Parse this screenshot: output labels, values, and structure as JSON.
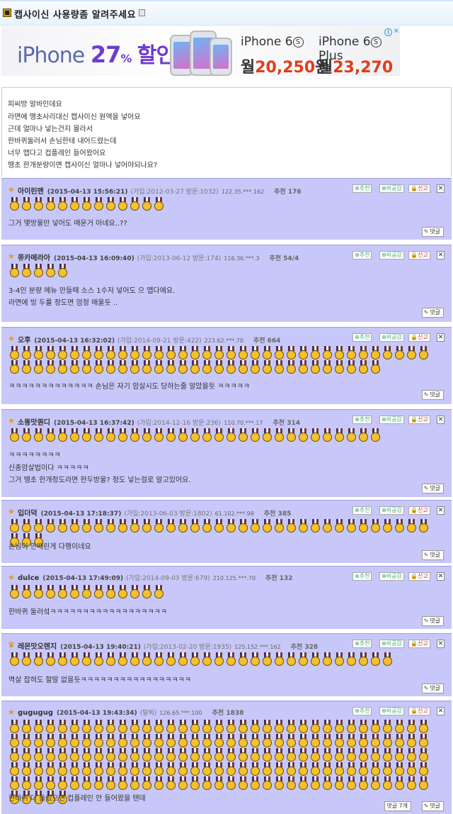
{
  "title": "캡사이신 사용량좀 알려주세요",
  "ad": {
    "left_text": "iPhone",
    "percent": "27",
    "percent_sign": "%",
    "sale": "할인!",
    "model1": "iPhone 6",
    "model2": "iPhone 6",
    "model_s": "S",
    "plus": "Plus",
    "price_prefix": "월",
    "price1": "20,250",
    "price2": "23,270",
    "price_suffix": "원",
    "info": "i",
    "close": "✕"
  },
  "post_lines": [
    "피씨방 알바인데요",
    "라면에 땡초사리대신 캡사이신 원액을 넣어요",
    "근데 얼마나 넣는건지 몰라서",
    "한바퀴둘러서 손님한테 내어드렸는데",
    "너무 맵다고 컵플레인 들어왔어요",
    "땡초 한개분량이면 캡사이신 얼마나 넣어야되나요?"
  ],
  "buttons": {
    "recommend": "추천",
    "nonpublic": "비공감",
    "report": "신고",
    "close": "✕",
    "reply": "댓글",
    "replies_count": "댓글 7개"
  },
  "comments": [
    {
      "star": "★",
      "name": "아이린맨",
      "date": "(2015-04-13 15:56:21)",
      "meta": "(가입:2012-03-27 방문:1032)",
      "ip": "122.35.***.162",
      "rec": "추천 176",
      "medals": 13,
      "text": "그거 몇방울만 넣어도 매운거 아네요..??"
    },
    {
      "star": "★",
      "name": "쮸카메라아",
      "date": "(2015-04-13 16:09:40)",
      "meta": "(가입:2013-06-12 방문:174)",
      "ip": "116.36.***.3",
      "rec": "추천 54/4",
      "medals": 5,
      "text": "3-4인 분량 메뉴 만들때 소스 1수저 넣어도 으 맵다에요.",
      "text2": "라면에 빙 두룰 정도면 엄청 매울듯 .."
    },
    {
      "star": "★",
      "name": "오후",
      "date": "(2015-04-13 16:32:02)",
      "meta": "(가입:2014-09-21 방문:422)",
      "ip": "223.62.***.70",
      "rec": "추천 664",
      "medals": 66,
      "text": "ㅋㅋㅋㅋㅋㅋㅋㅋㅋㅋㅋㅋㅋ 손님은 자기 암살시도 당하는줄 알았을듯 ㅋㅋㅋㅋㅋ"
    },
    {
      "star": "★",
      "name": "소똥맛퀀디",
      "date": "(2015-04-13 16:37:42)",
      "meta": "(가입:2014-12-16 방문:236)",
      "ip": "110.70.***.17",
      "rec": "추천 314",
      "medals": 31,
      "text": "ㅋㅋㅋㅋㅋㅋㅋㅋ",
      "text2": "신종암살법이다 ㅋㅋㅋㅋㅋ",
      "text3": "그거 땡초 한개정도라면 한두방울? 정도 넣는걸로 알고있어요."
    },
    {
      "star": "★",
      "name": "입더덕",
      "date": "(2015-04-13 17:18:37)",
      "meta": "(가입:2013-06-03 방문:1802)",
      "ip": "61.102.***.98",
      "rec": "추천 385",
      "medals": 38,
      "text": "손님이 안때린게 다행이네요"
    },
    {
      "star": "★",
      "name": "dulce",
      "date": "(2015-04-13 17:49:09)",
      "meta": "(가입:2014-09-03 방문:679)",
      "ip": "210.125.***.70",
      "rec": "추천 132",
      "medals": 13,
      "text": "한바퀴 둘러섴ㅋㅋㅋㅋㅋㅋㅋㅋㅋㅋㅋㅋㅋㅋㅋㅋㅋㅋ"
    },
    {
      "star": "♛",
      "name": "레몬맛오렌지",
      "date": "(2015-04-13 19:40:21)",
      "meta": "(가입:2013-02-20 방문:1935)",
      "ip": "125.152.***.162",
      "rec": "추천 328",
      "medals": 32,
      "text": "멱살 잡혀도 할말 없을듯ㅋㅋㅋㅋㅋㅋㅋㅋㅋㅋㅋㅋㅋㅋㅋㅋㅋ"
    },
    {
      "star": "★",
      "name": "gugugug",
      "date": "(2015-04-13 19:43:34)",
      "meta": "(탈퇴)",
      "ip": "126.65.***.100",
      "rec": "추천 1838",
      "medals": 180,
      "text": "한바퀴 더 둘렀으면 컵플레인 안 들어왔을 텐데"
    }
  ]
}
